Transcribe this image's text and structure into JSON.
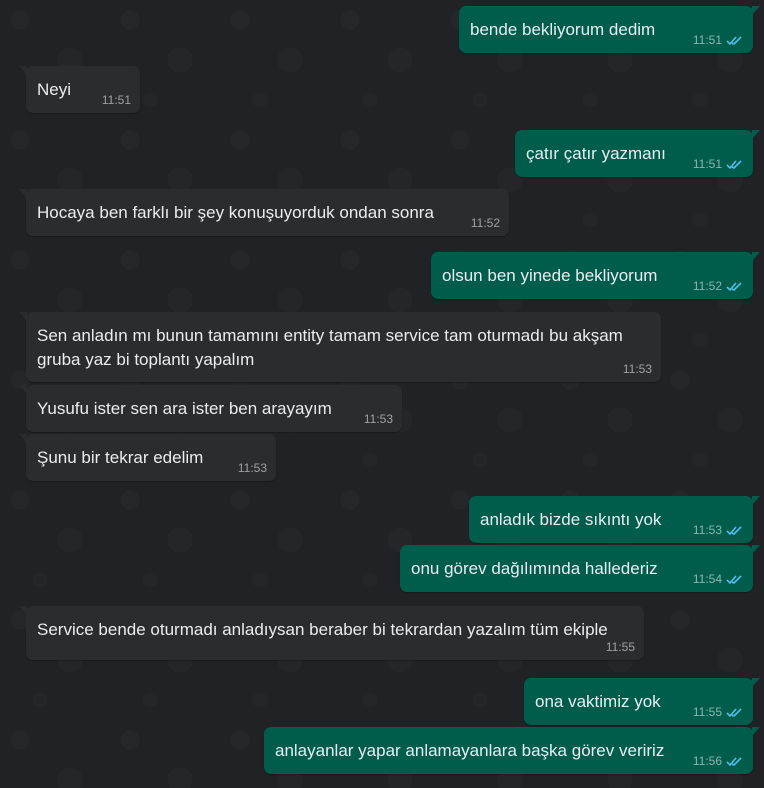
{
  "colors": {
    "background": "#202225",
    "incoming": "#2b2c2f",
    "outgoing": "#005c4b",
    "tick_read": "#53bdeb"
  },
  "messages": [
    {
      "dir": "out",
      "text": "bende bekliyorum dedim",
      "time": "11:51",
      "status": "read-ticks-icon"
    },
    {
      "dir": "in",
      "text": "Neyi",
      "time": "11:51"
    },
    {
      "dir": "out",
      "text": "çatır çatır yazmanı",
      "time": "11:51",
      "status": "read-ticks-icon"
    },
    {
      "dir": "in",
      "text": "Hocaya ben farklı bir şey konuşuyorduk ondan sonra",
      "time": "11:52"
    },
    {
      "dir": "out",
      "text": "olsun ben yinede bekliyorum",
      "time": "11:52",
      "status": "read-ticks-icon"
    },
    {
      "dir": "in",
      "text": "Sen anladın mı bunun tamamını entity tamam service tam oturmadı bu akşam gruba yaz bi toplantı yapalım",
      "time": "11:53"
    },
    {
      "dir": "in",
      "text": "Yusufu ister sen ara ister ben arayayım",
      "time": "11:53"
    },
    {
      "dir": "in",
      "text": "Şunu bir tekrar edelim",
      "time": "11:53"
    },
    {
      "dir": "out",
      "text": "anladık bizde sıkıntı yok",
      "time": "11:53",
      "status": "read-ticks-icon"
    },
    {
      "dir": "out",
      "text": "onu görev dağılımında hallederiz",
      "time": "11:54",
      "status": "read-ticks-icon"
    },
    {
      "dir": "in",
      "text": "Service bende oturmadı anladıysan beraber bi tekrardan yazalım tüm ekiple",
      "time": "11:55"
    },
    {
      "dir": "out",
      "text": "ona vaktimiz yok",
      "time": "11:55",
      "status": "read-ticks-icon"
    },
    {
      "dir": "out",
      "text": "anlayanlar yapar anlamayanlara başka görev veririz",
      "time": "11:56",
      "status": "read-ticks-icon"
    }
  ]
}
